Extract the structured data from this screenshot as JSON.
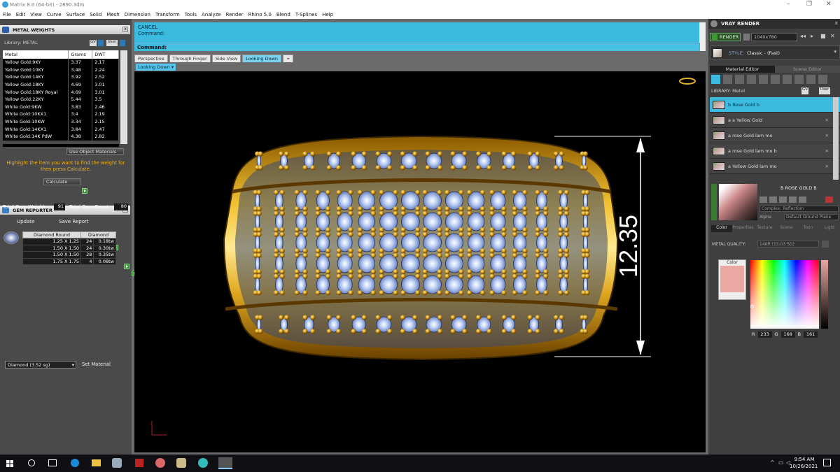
{
  "window": {
    "title": "Matrix 8.0 (64-bit) - 2890.3dm"
  },
  "menu": [
    "File",
    "Edit",
    "View",
    "Curve",
    "Surface",
    "Solid",
    "Mesh",
    "Dimension",
    "Transform",
    "Tools",
    "Analyze",
    "Render",
    "Rhino 5.0",
    "Blend",
    "T-Splines",
    "Help"
  ],
  "metal_weights": {
    "title": "METAL WEIGHTS",
    "library_label": "Library: METAL",
    "gv": "GV",
    "user": "User",
    "columns": [
      "Metal",
      "Grams",
      "DWT"
    ],
    "rows": [
      [
        "Yellow Gold:9KY",
        "3.37",
        "2.17"
      ],
      [
        "Yellow Gold:10KY",
        "3.48",
        "2.24"
      ],
      [
        "Yellow Gold:14KY",
        "3.92",
        "2.52"
      ],
      [
        "Yellow Gold:18KY",
        "4.69",
        "3.01"
      ],
      [
        "Yellow Gold:18KY Royal",
        "4.69",
        "3.01"
      ],
      [
        "Yellow Gold:22KY",
        "5.44",
        "3.5"
      ],
      [
        "White Gold:9KW",
        "3.83",
        "2.46"
      ],
      [
        "White Gold:10KX1",
        "3.4",
        "2.19"
      ],
      [
        "White Gold:10KW",
        "3.34",
        "2.15"
      ],
      [
        "White Gold:14KX1",
        "3.84",
        "2.47"
      ],
      [
        "White Gold:14K PdW",
        "4.38",
        "2.82"
      ]
    ],
    "use_object_materials": "Use Object Materials",
    "hint": "Highlight the item you want to find the weight for then press Calculate.",
    "calculate": "Calculate"
  },
  "gem_reporter": {
    "title": "GEM REPORTER",
    "total_weight_label": "Total Gem Weight",
    "total_weight": "91",
    "total_count_label": "Total Gem Count",
    "total_count": "80",
    "update": "Update",
    "save_report": "Save Report",
    "columns": [
      "Diamond Round",
      "Diamond"
    ],
    "rows": [
      [
        "1.25 X 1.25",
        "24",
        "0.18tw"
      ],
      [
        "1.50 X 1.50",
        "24",
        "0.30tw"
      ],
      [
        "1.50 X 1.50",
        "28",
        "0.35tw"
      ],
      [
        "1.75 X 1.75",
        "4",
        "0.08tw"
      ]
    ],
    "material_select": "Diamond    (3.52 sg)",
    "set_material": "Set Material"
  },
  "command": {
    "line1": "CANCEL",
    "line2": "Command:",
    "prompt": "Command:"
  },
  "tabs": [
    "Perspective",
    "Through Finger",
    "Side View",
    "Looking Down",
    "+"
  ],
  "viewport": {
    "label": "Looking Down",
    "dimension": "12.35"
  },
  "vray": {
    "title": "VRAY RENDER",
    "render": "RENDER",
    "resolution": "1040x780",
    "style_label": "STYLE:",
    "style_value": "Classic - (Fast)",
    "tabs": [
      "Material Editor",
      "Scene Editor"
    ],
    "library": "LIBRARY: Metal",
    "materials": [
      "b Rose Gold b",
      "a a Yellow Gold",
      "a rose Gold lam mo",
      "a rose Gold lam mo b",
      "a Yellow Gold lam mo"
    ],
    "selected_name": "B ROSE GOLD B",
    "complex": "Complex: Reflection",
    "alpha": "Alpha",
    "ground": "Default Ground Plane",
    "subtabs": [
      "Color",
      "Properties",
      "Texture",
      "Scene",
      "Toon",
      "Light"
    ],
    "metal_quality_label": "METAL QUALITY:",
    "metal_quality": "14KR        (13.03 SG)",
    "color_label": "Color",
    "rgb": [
      "233",
      "168",
      "161"
    ],
    "swatch": "#e9a8a1"
  },
  "taskbar": {
    "time": "9:54 AM",
    "date": "10/26/2021"
  }
}
